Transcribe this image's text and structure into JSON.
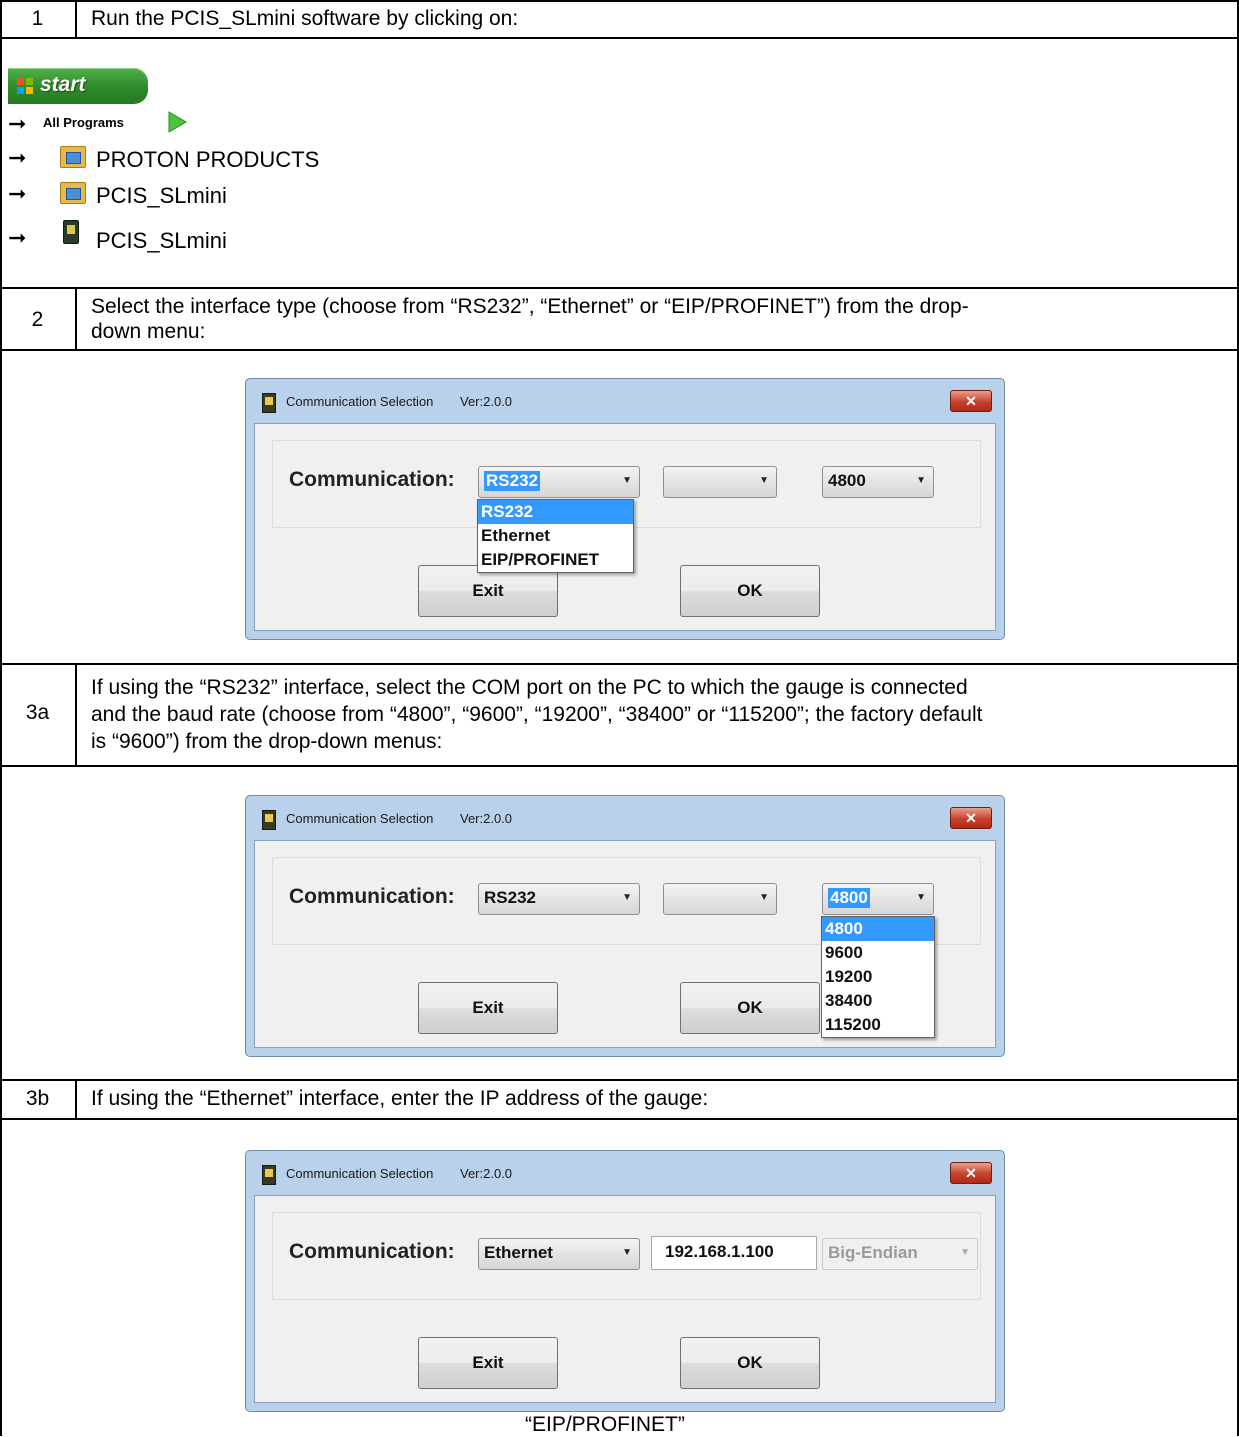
{
  "rows": {
    "r1": {
      "num": "1",
      "text": "Run the PCIS_SLmini software by clicking on:"
    },
    "r2": {
      "num": "2",
      "text_line1": "Select the interface type (choose from “RS232”, “Ethernet” or “EIP/PROFINET”) from the drop-",
      "text_line2": "down menu:"
    },
    "r3a": {
      "num": "3a",
      "text_line1": "If using the “RS232” interface, select the COM port on the PC to which the gauge is connected",
      "text_line2": "and the baud rate (choose from “4800”, “9600”, “19200”, “38400” or “115200”; the factory default",
      "text_line3": "is “9600”) from the drop-down menus:"
    },
    "r3b": {
      "num": "3b",
      "text": "If using the “Ethernet” interface, enter the IP address of the gauge:"
    }
  },
  "start_menu": {
    "start_label": "start",
    "all_programs": "All Programs",
    "path": [
      "PROTON PRODUCTS",
      "PCIS_SLmini",
      "PCIS_SLmini"
    ]
  },
  "dialog": {
    "title": "Communication Selection",
    "version": "Ver:2.0.0",
    "close_symbol": "✕",
    "comm_label": "Communication:",
    "exit_label": "Exit",
    "ok_label": "OK"
  },
  "dialog1": {
    "comm_value": "RS232",
    "port_value": "",
    "baud_value": "4800",
    "options": [
      "RS232",
      "Ethernet",
      "EIP/PROFINET"
    ]
  },
  "dialog2": {
    "comm_value": "RS232",
    "port_value": "",
    "baud_value": "4800",
    "options": [
      "4800",
      "9600",
      "19200",
      "38400",
      "115200"
    ]
  },
  "dialog3": {
    "comm_value": "Ethernet",
    "ip_value": "192.168.1.100",
    "endian_value": "Big-Endian"
  },
  "footer_text": "“EIP/PROFINET”",
  "colors": {
    "titlebar": "#b9d1ea",
    "selection": "#3399ff",
    "start_green": "#2e8a2b",
    "close_red": "#c7402c"
  }
}
